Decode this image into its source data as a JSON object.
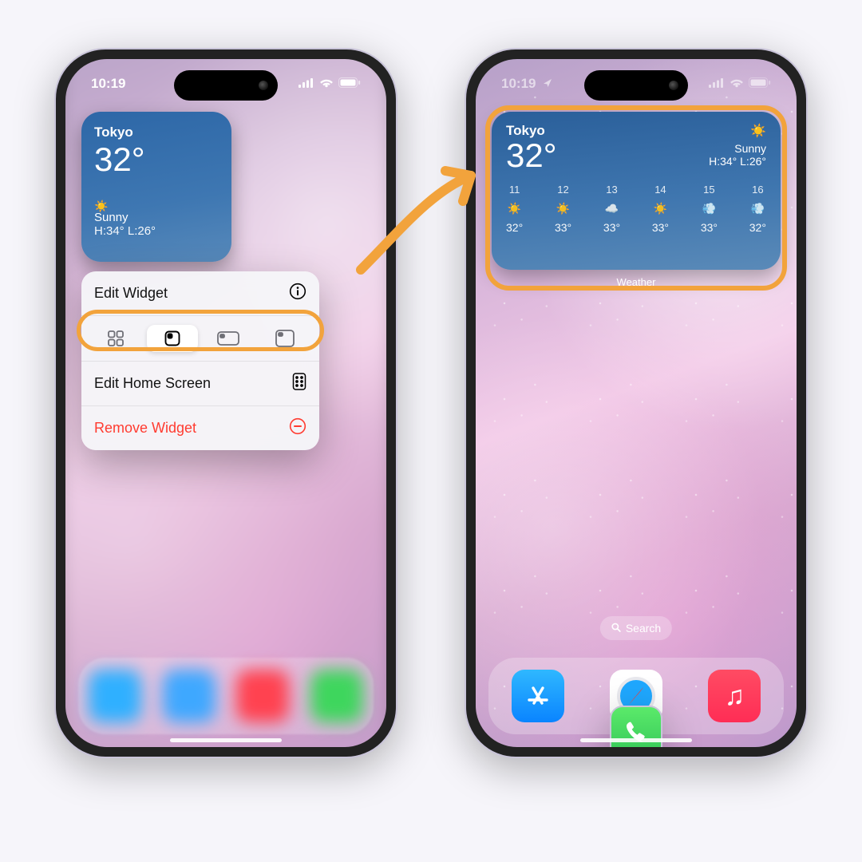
{
  "colors": {
    "highlight": "#f2a33c",
    "danger": "#ff3b30"
  },
  "status": {
    "time": "10:19"
  },
  "weather_small": {
    "city": "Tokyo",
    "temp": "32°",
    "condition": "Sunny",
    "hilo": "H:34° L:26°"
  },
  "menu": {
    "edit_widget": "Edit Widget",
    "edit_home": "Edit Home Screen",
    "remove": "Remove Widget",
    "size_options": [
      "apps-grid",
      "small",
      "medium",
      "large"
    ],
    "selected_index": 1
  },
  "weather_medium": {
    "city": "Tokyo",
    "temp": "32°",
    "condition": "Sunny",
    "hilo": "H:34° L:26°",
    "label": "Weather",
    "hours": [
      {
        "h": "11",
        "icon": "sun",
        "t": "32°"
      },
      {
        "h": "12",
        "icon": "sun",
        "t": "33°"
      },
      {
        "h": "13",
        "icon": "cloud",
        "t": "33°"
      },
      {
        "h": "14",
        "icon": "sun",
        "t": "33°"
      },
      {
        "h": "15",
        "icon": "wind",
        "t": "33°"
      },
      {
        "h": "16",
        "icon": "wind",
        "t": "32°"
      }
    ]
  },
  "search_label": "Search",
  "dock": [
    "appstore",
    "safari",
    "music",
    "phone"
  ]
}
